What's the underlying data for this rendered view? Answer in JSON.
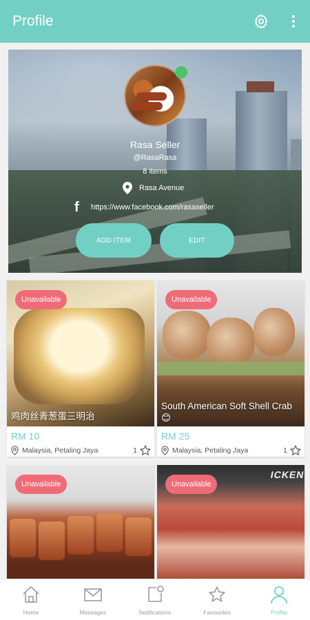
{
  "appbar": {
    "title": "Profile",
    "settings_icon": "gear-icon",
    "more_icon": "more-vertical-icon",
    "background_color": "#72cfc3"
  },
  "profile": {
    "name": "Rasa Seller",
    "handle": "@RasaRasa",
    "items_count": "8 items",
    "location": "Rasa Avenue",
    "facebook_url": "https://www.facebook.com/rasaseller",
    "online_status_color": "#4cc36a",
    "buttons": {
      "add_item": "ADD ITEM",
      "edit": "EDIT"
    }
  },
  "listings": [
    {
      "status": "Unavailable",
      "name": "鸡肉丝青葱蛋三明治",
      "price": "RM 10",
      "location": "Malaysia, Petaling Jaya",
      "favourites": "1"
    },
    {
      "status": "Unavailable",
      "name": "South American Soft Shell Crab😊",
      "price": "RM 25",
      "location": "Malaysia, Petaling Jaya",
      "favourites": "1"
    },
    {
      "status": "Unavailable",
      "name": "",
      "price": "",
      "location": "",
      "favourites": ""
    },
    {
      "status": "Unavailable",
      "name": "",
      "price": "",
      "location": "",
      "favourites": "",
      "photo_text": "ICKEN"
    }
  ],
  "bottom_nav": {
    "items": [
      {
        "label": "Home",
        "icon": "home-icon"
      },
      {
        "label": "Messages",
        "icon": "mail-icon"
      },
      {
        "label": "Notifications",
        "icon": "notification-icon"
      },
      {
        "label": "Favourites",
        "icon": "star-icon"
      },
      {
        "label": "Profile",
        "icon": "person-icon"
      }
    ],
    "active": "Profile"
  },
  "colors": {
    "accent": "#72cfc3",
    "badge": "#f06b78",
    "inactive_nav": "#9a9a9a"
  }
}
